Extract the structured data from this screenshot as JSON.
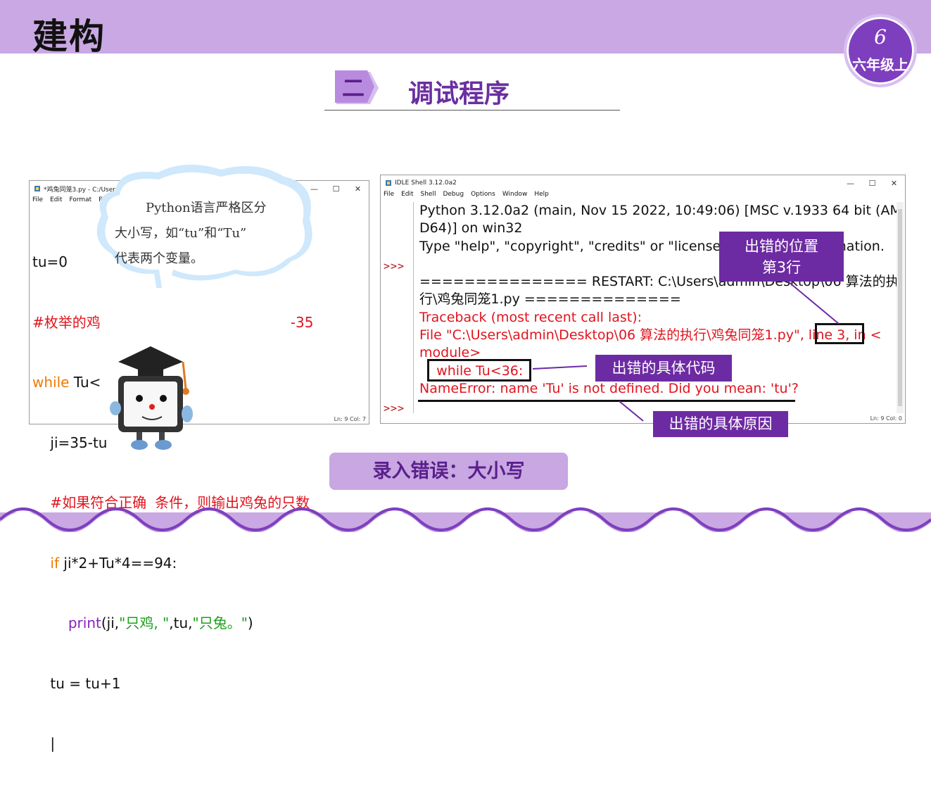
{
  "header": {
    "title": "建构",
    "grade_num": "6",
    "grade_label": "六年级上"
  },
  "section": {
    "number": "二",
    "title": "调试程序"
  },
  "editor": {
    "title": "*鸡兔同笼3.py - C:/Users/a",
    "menu": [
      "File",
      "Edit",
      "Format",
      "Run"
    ],
    "lines": {
      "l1": "tu=0",
      "l2a": "#枚举的鸡",
      "l2b": "-35",
      "l3a": "while",
      "l3b": " Tu<",
      "l4": "    ji=35-tu",
      "l5a": "    #如果符合正确",
      "l5b": "条件，则输出鸡兔的只数",
      "l6a": "    if",
      "l6b": " ji*2+Tu*4==94:",
      "l7a": "        ",
      "l7b": "print",
      "l7c": "(ji,",
      "l7d": "\"只鸡, \"",
      "l7e": ",tu,",
      "l7f": "\"只兔。\"",
      "l7g": ")",
      "l8": "    tu = tu+1"
    },
    "status": "Ln: 9   Col: 7"
  },
  "shell": {
    "title": "IDLE Shell 3.12.0a2",
    "menu": [
      "File",
      "Edit",
      "Shell",
      "Debug",
      "Options",
      "Window",
      "Help"
    ],
    "prompt": ">>>",
    "lines": {
      "l1": "Python 3.12.0a2 (main, Nov 15 2022, 10:49:06) [MSC v.1933 64 bit (AM",
      "l2": "D64)] on win32",
      "l3": "Type \"help\", \"copyright\", \"credits\" or \"license()\" for more information.",
      "l4": "=============== RESTART: C:\\Users\\admin\\Desktop\\06 算法的执",
      "l5": "行\\鸡兔同笼1.py ==============",
      "l6": "Traceback (most recent call last):",
      "l7": "  File \"C:\\Users\\admin\\Desktop\\06 算法的执行\\鸡兔同笼1.py\", line 3, in <",
      "l8": "module>",
      "l9": "    while Tu<36:",
      "l10": "NameError: name 'Tu' is not defined. Did you mean: 'tu'?"
    },
    "status": "Ln: 9   Col: 0"
  },
  "bubble": {
    "line1": "Python语言严格区分",
    "line2": "大小写，如“tu”和“Tu”",
    "line3": "代表两个变量。"
  },
  "tags": {
    "position": [
      "出错的位置",
      "第3行"
    ],
    "code": "出错的具体代码",
    "reason": "出错的具体原因"
  },
  "caption": "录入错误：大小写",
  "colors": {
    "accent": "#6d2ba3",
    "bar": "#c9a8e3",
    "error": "#e0141e"
  }
}
